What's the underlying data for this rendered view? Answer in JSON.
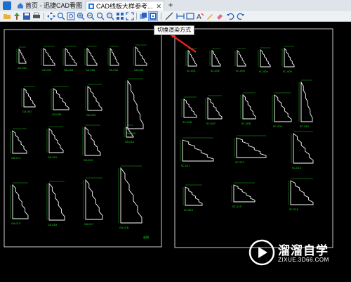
{
  "tabs": [
    {
      "label": "首页 - 迅捷CAD看图"
    },
    {
      "label": "CAD线板大样参考..."
    }
  ],
  "tooltip": "切换渲染方式",
  "drawing": {
    "left_sheet": {
      "labels": [
        "GX-001",
        "GX-002",
        "GX-003",
        "GX-004",
        "GX-005",
        "GX-006",
        "GX-007",
        "GX-008",
        "GX-009",
        "GX-010",
        "GX-011",
        "GX-012",
        "GX-013",
        "GX-014",
        "GX-015",
        "GX-016",
        "GX-017",
        "GX-018",
        "GX-019",
        "GX-020"
      ],
      "note": "说明"
    },
    "right_sheet": {
      "labels": [
        "SC-001",
        "SC-002",
        "SC-003",
        "SC-004",
        "SC-005",
        "SC-006",
        "SC-007",
        "SC-008",
        "SC-009",
        "SC-010",
        "SC-011",
        "SC-012",
        "SC-013",
        "SC-014",
        "SC-015",
        "SC-016",
        "SC-017",
        "SC-018"
      ]
    }
  },
  "watermark": {
    "title": "溜溜自学",
    "url": "ZIXUE.3D66.COM"
  },
  "colors": {
    "annotation": "#ff2020",
    "sheet_border": "#ffffff",
    "moulding": "#ffffff",
    "dimension": "#19e619"
  }
}
